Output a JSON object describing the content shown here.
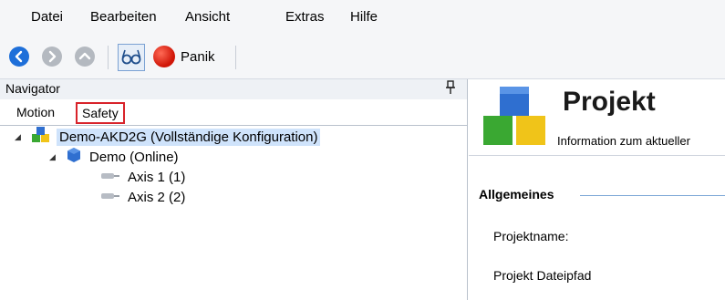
{
  "menubar": {
    "items": [
      "Datei",
      "Bearbeiten",
      "Ansicht",
      "Extras",
      "Hilfe"
    ]
  },
  "toolbar": {
    "buttons": [
      {
        "icon": "back-arrow-icon",
        "color": "#1e6fd9"
      },
      {
        "icon": "forward-arrow-icon",
        "color": "#b4b9c0"
      },
      {
        "icon": "up-arrow-icon",
        "color": "#b4b9c0"
      },
      {
        "icon": "glasses-icon"
      }
    ],
    "panic_label": "Panik",
    "panic_color": "#d01608"
  },
  "navigator": {
    "title": "Navigator",
    "pin_icon": "pin-icon",
    "tabs": [
      "Motion",
      "Safety"
    ],
    "highlighted_tab": "Safety",
    "tree": [
      {
        "label": "Demo-AKD2G (Vollständige Konfiguration)",
        "icon": "project-cubes-icon",
        "expanded": true,
        "selected": true
      },
      {
        "label": "Demo (Online)",
        "icon": "device-cube-icon",
        "expanded": true
      },
      {
        "label": "Axis 1 (1)",
        "icon": "axis-icon"
      },
      {
        "label": "Axis 2 (2)",
        "icon": "axis-icon"
      }
    ]
  },
  "project": {
    "title": "Projekt",
    "subtitle": "Information zum aktueller",
    "section": "Allgemeines",
    "fields": [
      "Projektname:",
      "Projekt Dateipfad"
    ]
  },
  "colors": {
    "accent": "#1e6fd9",
    "selection": "#cfe3fb",
    "highlight_border": "#d8232a"
  }
}
